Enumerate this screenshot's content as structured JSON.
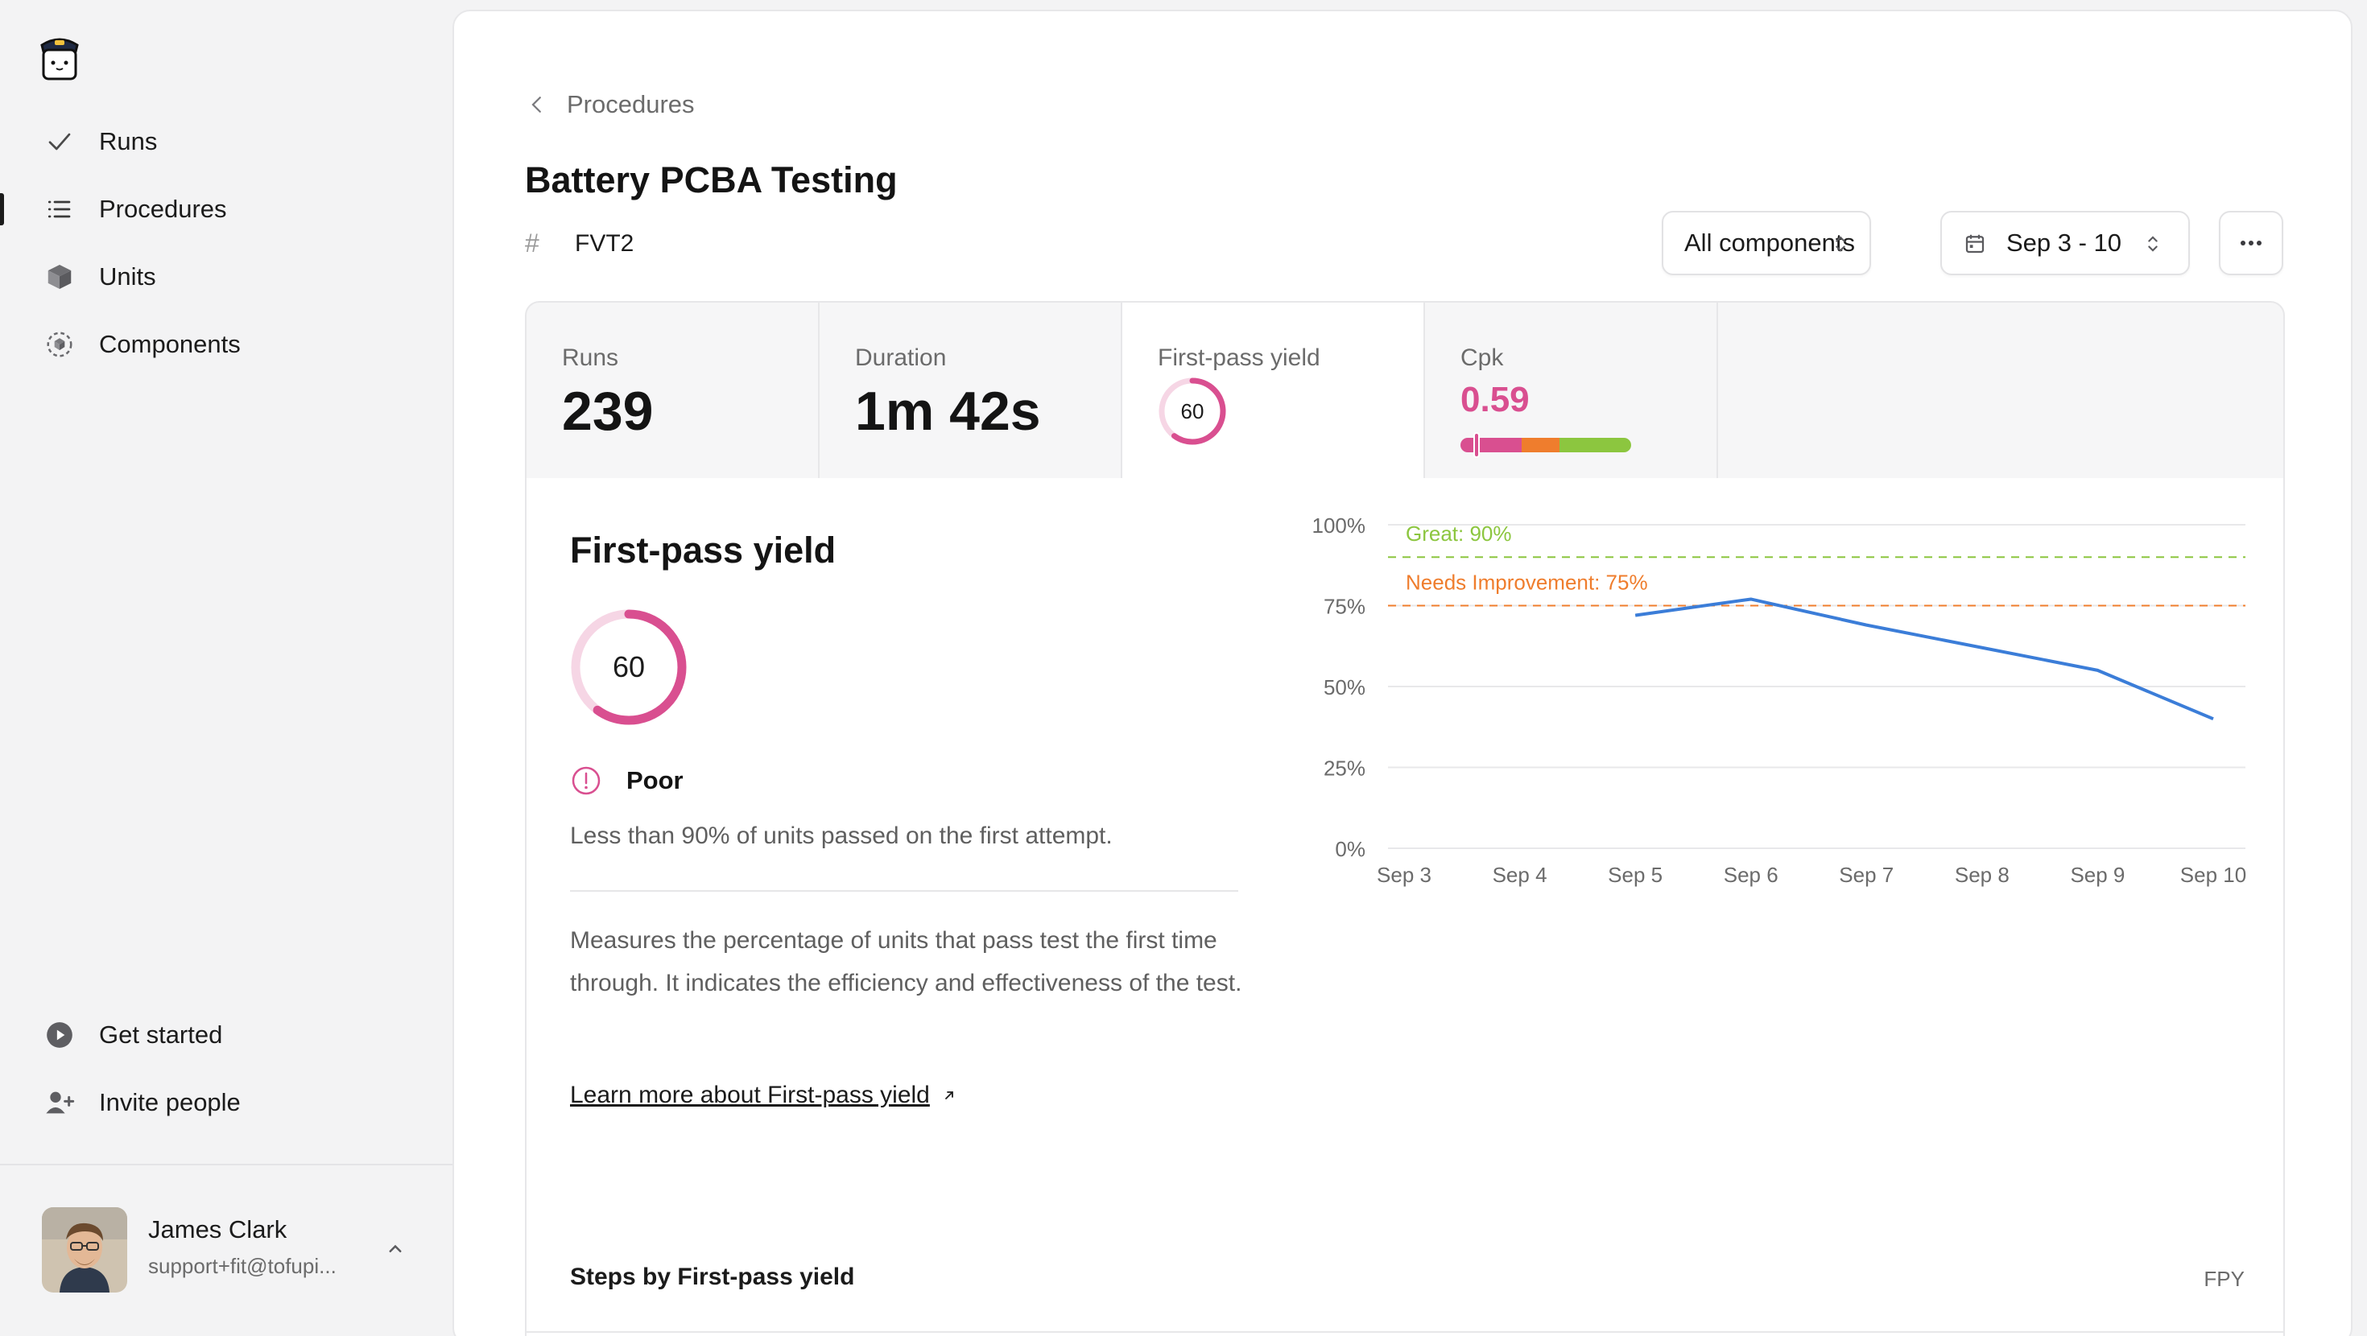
{
  "sidebar": {
    "items": [
      {
        "label": "Runs",
        "icon": "check-icon"
      },
      {
        "label": "Procedures",
        "icon": "list-icon"
      },
      {
        "label": "Units",
        "icon": "cube-icon"
      },
      {
        "label": "Components",
        "icon": "component-icon"
      }
    ],
    "bottom_items": [
      {
        "label": "Get started",
        "icon": "play-circle-icon"
      },
      {
        "label": "Invite people",
        "icon": "user-plus-icon"
      }
    ],
    "user": {
      "name": "James Clark",
      "email": "support+fit@tofupi..."
    }
  },
  "breadcrumb": {
    "label": "Procedures"
  },
  "page": {
    "title": "Battery PCBA Testing",
    "tag_symbol": "#",
    "tag": "FVT2"
  },
  "toolbar": {
    "components": "All components",
    "date_range": "Sep 3 - 10"
  },
  "metrics": {
    "runs": {
      "label": "Runs",
      "value": "239"
    },
    "duration": {
      "label": "Duration",
      "value": "1m 42s"
    },
    "fpy": {
      "label": "First-pass yield",
      "value": "60"
    },
    "cpk": {
      "label": "Cpk",
      "value": "0.59"
    }
  },
  "fpy_panel": {
    "title": "First-pass yield",
    "score": "60",
    "score_fraction": 0.6,
    "status": "Poor",
    "summary": "Less than 90% of units passed on the first attempt.",
    "description": "Measures the percentage of units that pass test the first time through. It indicates the efficiency and effectiveness of the test.",
    "learn_more": "Learn more about First-pass yield"
  },
  "colors": {
    "accent_blue": "#3b7dd8",
    "poor_pink": "#d94f90",
    "great_green": "#8cc63f",
    "needs_orange": "#ef7d2d"
  },
  "chart_data": {
    "type": "line",
    "x": [
      "Sep 3",
      "Sep 4",
      "Sep 5",
      "Sep 6",
      "Sep 7",
      "Sep 8",
      "Sep 9",
      "Sep 10"
    ],
    "series": [
      {
        "values": [
          null,
          null,
          72,
          77,
          69,
          62,
          55,
          40
        ]
      }
    ],
    "ylim": [
      0,
      100
    ],
    "y_ticks": [
      "0%",
      "25%",
      "50%",
      "75%",
      "100%"
    ],
    "thresholds": [
      {
        "label": "Great: 90%",
        "value": 90
      },
      {
        "label": "Needs Improvement: 75%",
        "value": 75
      }
    ],
    "grid": true
  },
  "steps": {
    "title": "Steps by First-pass yield",
    "column": "FPY"
  }
}
